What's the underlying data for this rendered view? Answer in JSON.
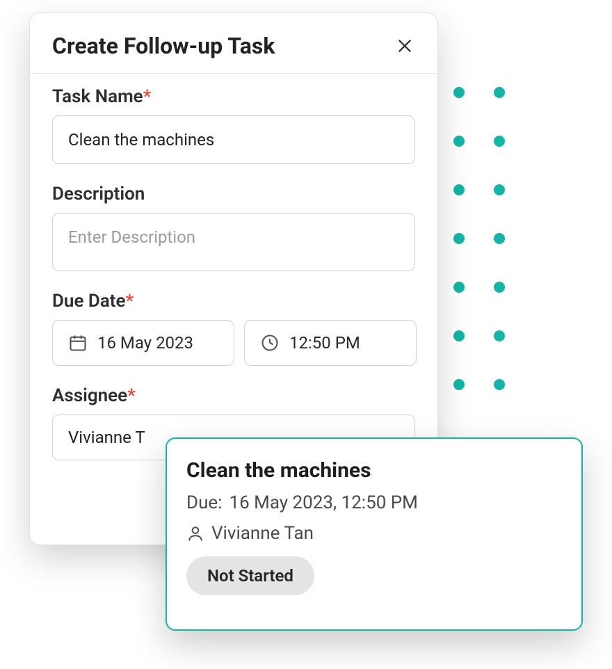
{
  "modal": {
    "title": "Create Follow-up Task",
    "fields": {
      "task_name": {
        "label": "Task Name",
        "required_marker": "*",
        "value": "Clean the machines"
      },
      "description": {
        "label": "Description",
        "placeholder": "Enter Description"
      },
      "due_date": {
        "label": "Due Date",
        "required_marker": "*",
        "date": "16 May 2023",
        "time": "12:50 PM"
      },
      "assignee": {
        "label": "Assignee",
        "required_marker": "*",
        "value_visible": "Vivianne T"
      }
    }
  },
  "task_card": {
    "title": "Clean the machines",
    "due_prefix": "Due: ",
    "due_value": "16 May 2023, 12:50 PM",
    "assignee": "Vivianne Tan",
    "status": "Not Started"
  }
}
